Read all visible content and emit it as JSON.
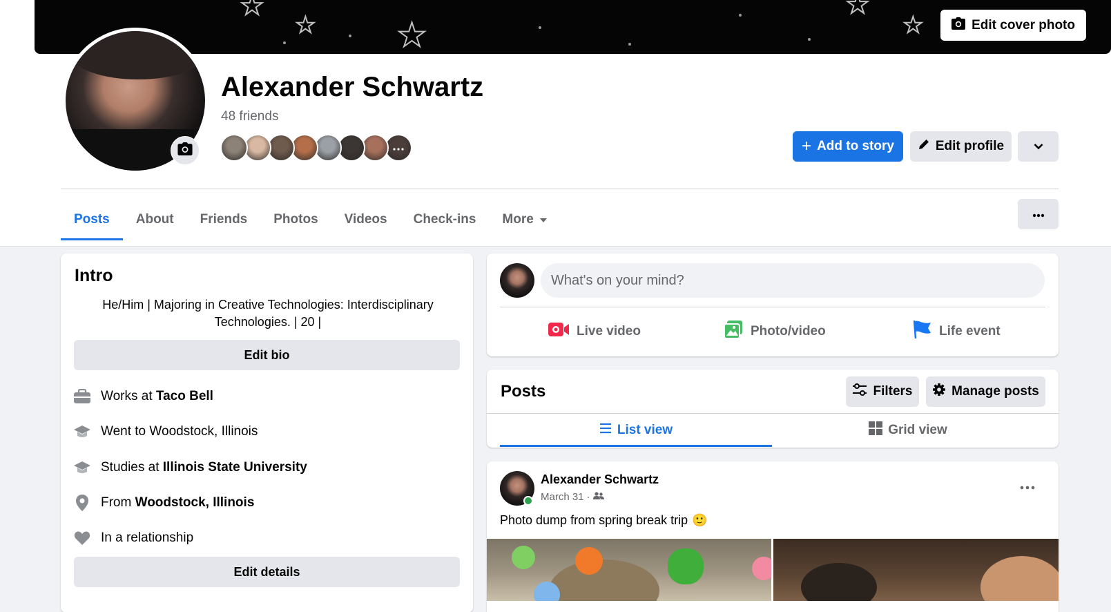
{
  "cover": {
    "edit_label": "Edit cover photo"
  },
  "profile": {
    "name": "Alexander Schwartz",
    "friends_count": "48 friends",
    "friend_faces": [
      "#8c8277",
      "#d8b8a2",
      "#6f5a4e",
      "#b56e4a",
      "#9aa0a6",
      "#3b3533",
      "#a7705c",
      "#4a3d3a"
    ]
  },
  "actions": {
    "add_story": "Add to story",
    "edit_profile": "Edit profile"
  },
  "tabs": [
    {
      "label": "Posts",
      "active": true
    },
    {
      "label": "About"
    },
    {
      "label": "Friends"
    },
    {
      "label": "Photos"
    },
    {
      "label": "Videos"
    },
    {
      "label": "Check-ins"
    },
    {
      "label": "More"
    }
  ],
  "intro": {
    "title": "Intro",
    "bio": "He/Him | Majoring in Creative Technologies: Interdisciplinary Technologies. | 20 |",
    "edit_bio": "Edit bio",
    "details": [
      {
        "icon": "briefcase-icon",
        "prefix": "Works at ",
        "bold": "Taco Bell"
      },
      {
        "icon": "graduation-cap-icon",
        "prefix": "Went to Woodstock, Illinois",
        "bold": ""
      },
      {
        "icon": "graduation-cap-icon",
        "prefix": "Studies at ",
        "bold": "Illinois State University"
      },
      {
        "icon": "location-pin-icon",
        "prefix": "From ",
        "bold": "Woodstock, Illinois"
      },
      {
        "icon": "heart-icon",
        "prefix": "In a relationship",
        "bold": ""
      }
    ],
    "edit_details": "Edit details"
  },
  "composer": {
    "placeholder": "What's on your mind?",
    "live_video": "Live video",
    "photo_video": "Photo/video",
    "life_event": "Life event"
  },
  "posts_panel": {
    "title": "Posts",
    "filters": "Filters",
    "manage": "Manage posts",
    "list_view": "List view",
    "grid_view": "Grid view"
  },
  "post": {
    "author": "Alexander Schwartz",
    "date": "March 31",
    "separator": "·",
    "text": "Photo dump from spring break trip",
    "emoji": "🙂"
  },
  "colors": {
    "accent": "#1b74e4",
    "live": "#f02849",
    "photo": "#45bd62",
    "life": "#1877f2"
  }
}
